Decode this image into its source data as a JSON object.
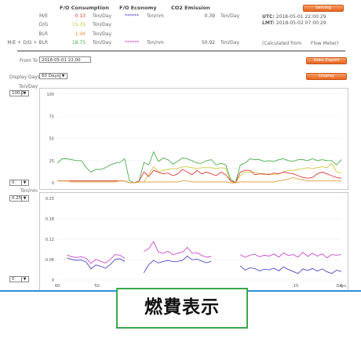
{
  "header": {
    "col_consumption": "F/O Consumption",
    "col_economy": "F/O Economy",
    "col_emission": "CO2 Emission",
    "setting_button": "Setting"
  },
  "rows": [
    {
      "label": "M/E",
      "value": "0.13",
      "value_color": "#e03a3a",
      "unit": "Ton/Day"
    },
    {
      "label": "D/G",
      "value": "15.19",
      "value_color": "#c9c93a",
      "unit": "Ton/Day"
    },
    {
      "label": "BLR",
      "value": "1.44",
      "value_color": "#e89a3a",
      "unit": "Ton/Day"
    },
    {
      "label": "M/E + D/G + BLR",
      "value": "18.75",
      "value_color": "#4caf50",
      "unit": "Ton/Day"
    }
  ],
  "economy": {
    "top_value": "******",
    "top_color": "#4a4acc",
    "top_unit": "Ton/nm",
    "bottom_value": "******",
    "bottom_color": "#cc4acc",
    "bottom_unit": "Ton/nm"
  },
  "emission": {
    "top_value": "0.39",
    "top_unit": "Ton/Day",
    "bottom_value": "50.92",
    "bottom_unit": "Ton/Day"
  },
  "times": {
    "utc_label": "UTC:",
    "utc_value": "2018-05-01 22:00:29",
    "lmt_label": "LMT:",
    "lmt_value": "2018-05-02 07:00:29",
    "calc_note": "(Calculated from",
    "flow_meter": "Flow Meter)"
  },
  "controls": {
    "from_to_label": "From To",
    "from_to_value": "2018-05-01 22:00",
    "display_days_label": "Display Days",
    "display_days_value": "60 Days",
    "data_export_button": "Data Export",
    "display_button": "Display"
  },
  "chart_data": [
    {
      "type": "line",
      "ylabel": "Ton/Day",
      "y_scale_select": "100.0",
      "y_min_select": "0",
      "ylim": [
        0,
        100
      ],
      "ytick_labels": [
        "100",
        "75",
        "50",
        "25",
        "0"
      ],
      "series": [
        {
          "color": "#4caf50",
          "values": [
            22,
            27,
            27,
            26,
            25,
            25,
            17,
            12,
            15,
            15,
            17,
            20,
            22,
            23,
            27,
            2,
            0,
            2,
            23,
            20,
            35,
            24,
            28,
            26,
            21,
            24,
            28,
            27,
            25,
            22,
            22,
            25,
            26,
            20,
            22,
            20,
            4,
            0,
            20,
            22,
            27,
            26,
            26,
            24,
            25,
            24,
            26,
            27,
            25,
            24,
            26,
            26,
            25,
            27,
            25,
            26,
            25,
            25,
            20,
            26
          ]
        },
        {
          "color": "#c9c93a",
          "values": [
            2,
            2,
            2,
            2,
            2,
            2,
            2,
            2,
            2,
            2,
            2,
            2,
            2,
            2,
            2,
            0,
            0,
            1,
            1,
            10,
            18,
            12,
            14,
            15,
            16,
            16,
            18,
            18,
            17,
            16,
            17,
            17,
            17,
            16,
            17,
            16,
            2,
            0,
            8,
            12,
            12,
            12,
            10,
            9,
            10,
            9,
            10,
            12,
            14,
            14,
            15,
            16,
            17,
            16,
            17,
            18,
            17,
            22,
            12,
            11
          ]
        },
        {
          "color": "#e03a3a",
          "values": [
            2,
            2,
            2,
            2,
            2,
            2,
            2,
            2,
            2,
            2,
            2,
            2,
            2,
            2,
            2,
            0,
            0,
            2,
            12,
            7,
            14,
            12,
            10,
            11,
            8,
            10,
            15,
            12,
            9,
            14,
            10,
            12,
            10,
            8,
            12,
            9,
            2,
            0,
            12,
            14,
            14,
            9,
            10,
            10,
            9,
            11,
            10,
            12,
            11,
            10,
            8,
            6,
            5,
            6,
            10,
            12,
            10,
            8,
            6,
            5
          ]
        },
        {
          "color": "#e89a3a",
          "values": [
            2,
            2,
            2,
            1,
            1,
            1,
            1,
            1,
            1,
            1,
            1,
            1,
            1,
            2,
            2,
            0,
            0,
            1,
            1,
            1,
            1,
            1,
            1,
            1,
            1,
            1,
            2,
            2,
            1,
            1,
            1,
            1,
            1,
            1,
            1,
            1,
            0,
            0,
            1,
            1,
            1,
            1,
            1,
            1,
            1,
            1,
            2,
            3,
            4,
            6,
            4,
            3,
            2,
            2,
            2,
            2,
            2,
            2,
            2,
            2
          ]
        }
      ]
    },
    {
      "type": "line",
      "ylabel": "Ton/nm",
      "y_scale_select": "0.25",
      "y_min_select": "0",
      "ylim": [
        0,
        0.25
      ],
      "ytick_labels": [
        "0.25",
        "0.18",
        "0.12",
        "0.06",
        "0"
      ],
      "xlabel": "Days",
      "xtick_labels": [
        "60",
        "50",
        "10",
        "0"
      ],
      "series": [
        {
          "color": "#cc4acc",
          "values": [
            null,
            null,
            0.077,
            0.071,
            0.069,
            0.071,
            0.066,
            0.051,
            0.063,
            0.058,
            0.052,
            0.063,
            0.078,
            0.076,
            0.066,
            null,
            null,
            null,
            0.088,
            0.096,
            0.118,
            0.085,
            0.082,
            0.088,
            0.077,
            0.082,
            0.085,
            0.1,
            0.082,
            0.084,
            0.075,
            0.07,
            0.072,
            null,
            null,
            null,
            null,
            null,
            0.078,
            0.069,
            0.076,
            0.079,
            0.071,
            0.076,
            0.073,
            0.08,
            0.07,
            0.083,
            0.075,
            0.078,
            0.07,
            0.085,
            0.072,
            0.082,
            0.073,
            0.08,
            0.068,
            0.078,
            0.076,
            0.078
          ]
        },
        {
          "color": "#4a4acc",
          "values": [
            null,
            null,
            0.067,
            0.063,
            0.06,
            0.061,
            0.055,
            0.034,
            0.046,
            0.042,
            0.036,
            0.047,
            0.063,
            0.065,
            0.057,
            null,
            null,
            null,
            0.022,
            0.047,
            0.06,
            0.052,
            0.057,
            0.06,
            0.056,
            0.057,
            0.06,
            0.073,
            0.062,
            0.064,
            0.058,
            0.053,
            0.057,
            null,
            null,
            null,
            null,
            null,
            0.043,
            0.03,
            0.037,
            0.035,
            0.028,
            0.033,
            0.031,
            0.036,
            0.028,
            0.04,
            0.032,
            0.026,
            0.02,
            0.034,
            0.029,
            0.035,
            0.027,
            0.034,
            0.025,
            0.02,
            0.03,
            0.026
          ]
        }
      ]
    }
  ],
  "caption": "燃費表示"
}
